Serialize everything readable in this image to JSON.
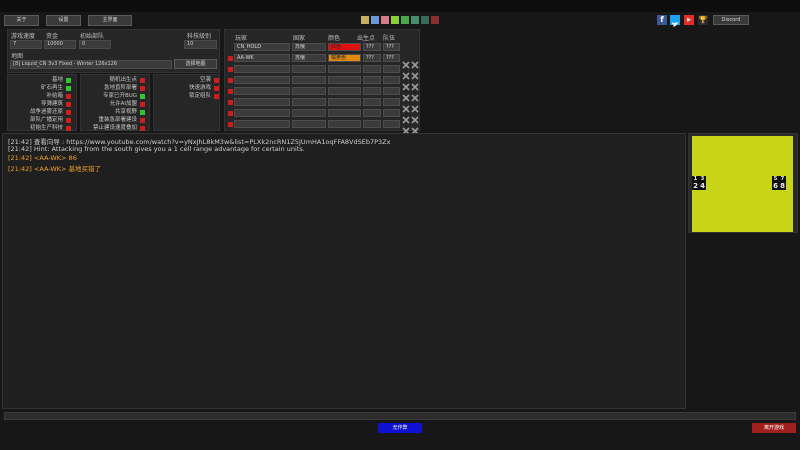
{
  "top_buttons": {
    "about": "关于",
    "settings": "设置",
    "main_menu": "主界面"
  },
  "palette": [
    "#c8b060",
    "#6a9ad8",
    "#d87a8a",
    "#8acf3a",
    "#4aa84a",
    "#4a8a70",
    "#3a6a5a",
    "#8a3030"
  ],
  "social": {
    "discord": "Discord",
    "facebook_glyph": "f",
    "youtube_glyph": "▶",
    "trophy_glyph": "🏆"
  },
  "settings": {
    "game_speed_label": "游戏速度",
    "game_speed": "7",
    "funds_label": "资金",
    "funds": "10000",
    "initial_units_label": "初始部队",
    "initial_units": "0",
    "tech_level_label": "科技级别",
    "tech_level": "10",
    "map_label": "地图",
    "map_value": "[8] Liquid_CN 3v3 Fixed - Winter 126x126",
    "change_map_button": "选择地图"
  },
  "options_left": [
    {
      "label": "基地",
      "on": true
    },
    {
      "label": "矿石再生",
      "on": true
    },
    {
      "label": "补给箱",
      "on": false
    },
    {
      "label": "导弹建筑",
      "on": false
    },
    {
      "label": "战争迷雾还原",
      "on": false
    },
    {
      "label": "部队广播定用",
      "on": false
    },
    {
      "label": "初始生产科技",
      "on": false
    }
  ],
  "options_right": [
    {
      "label": "随机出生点",
      "on": false
    },
    {
      "label": "急地直阶部署",
      "on": false
    },
    {
      "label": "专家已开BUG",
      "on": true
    },
    {
      "label": "允许AI加盟",
      "on": false
    },
    {
      "label": "共享视野",
      "on": true
    },
    {
      "label": "重装急部署建设",
      "on": false
    },
    {
      "label": "禁止建设速度叠加",
      "on": false
    }
  ],
  "options_third": [
    {
      "label": "空袭",
      "on": false
    },
    {
      "label": "快速游戏",
      "on": false
    },
    {
      "label": "锁定组队",
      "on": false
    }
  ],
  "players_table": {
    "headers": [
      "玩家",
      "国家",
      "颜色",
      "出生点",
      "队伍"
    ],
    "rows": [
      {
        "name": "CN_HOLD",
        "country": "苏俄",
        "color_name": "红色",
        "color": "#e01010",
        "start": "???",
        "team": "???"
      },
      {
        "name": "AA-WK",
        "country": "苏俄",
        "color_name": "橘黄色",
        "color": "#e08a10",
        "start": "???",
        "team": "???"
      }
    ],
    "empty_rows": 6
  },
  "chat": [
    {
      "time": "[21:42]",
      "text": "查看向导 : https://www.youtube.com/watch?v=yNxJhL8kM3w&list=PLXk2ncRN1Z5JUmHA1oqFFA8VdSEb7P3Zx",
      "color": "#cfcfcf"
    },
    {
      "time": "[21:42]",
      "text": "Hint: Attacking from the south gives you a 1 cell range advantage for certain units.",
      "color": "#cfcfcf"
    },
    {
      "time": "[21:42]",
      "text": "<AA-WK> 86",
      "color": "#f0a020"
    },
    {
      "time": "[21:42]",
      "text": "<AA-WK> 基地买错了",
      "color": "#f0a020"
    }
  ],
  "minimap": {
    "spawn_left": [
      "1",
      "3",
      "2",
      "4"
    ],
    "spawn_right": [
      "5",
      "7",
      "6",
      "8"
    ],
    "color": "#c8d418"
  },
  "bottom": {
    "ready_button": "无作弊",
    "leave_button": "离开游戏"
  }
}
